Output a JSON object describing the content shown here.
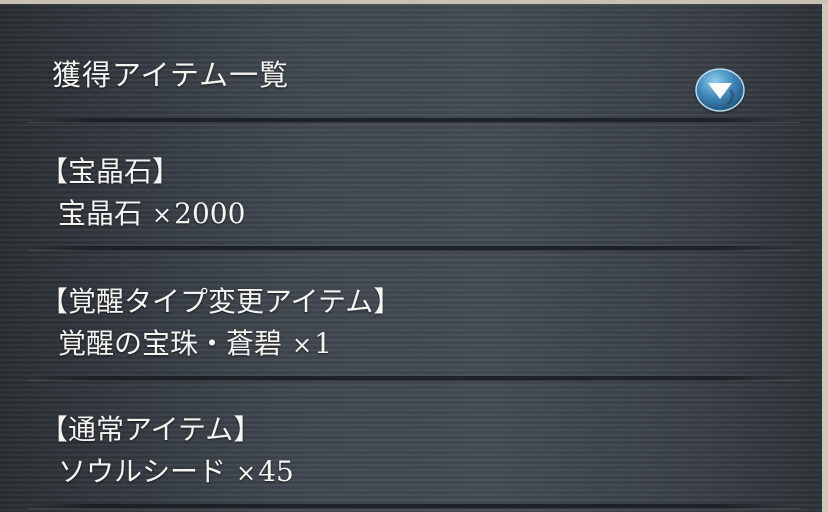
{
  "header": {
    "title": "獲得アイテム一覧",
    "toggle_icon": "chevron-down-circle-icon"
  },
  "sections": [
    {
      "heading": "【宝晶石】",
      "item_name": "宝晶石",
      "multiplier": "×",
      "quantity": "2000"
    },
    {
      "heading": "【覚醒タイプ変更アイテム】",
      "item_name": "覚醒の宝珠・蒼碧",
      "multiplier": "×",
      "quantity": "1"
    },
    {
      "heading": "【通常アイテム】",
      "item_name": "ソウルシード",
      "multiplier": "×",
      "quantity": "45"
    }
  ],
  "colors": {
    "text": "#f4f4f1",
    "accent_button": "#4f97c8"
  }
}
